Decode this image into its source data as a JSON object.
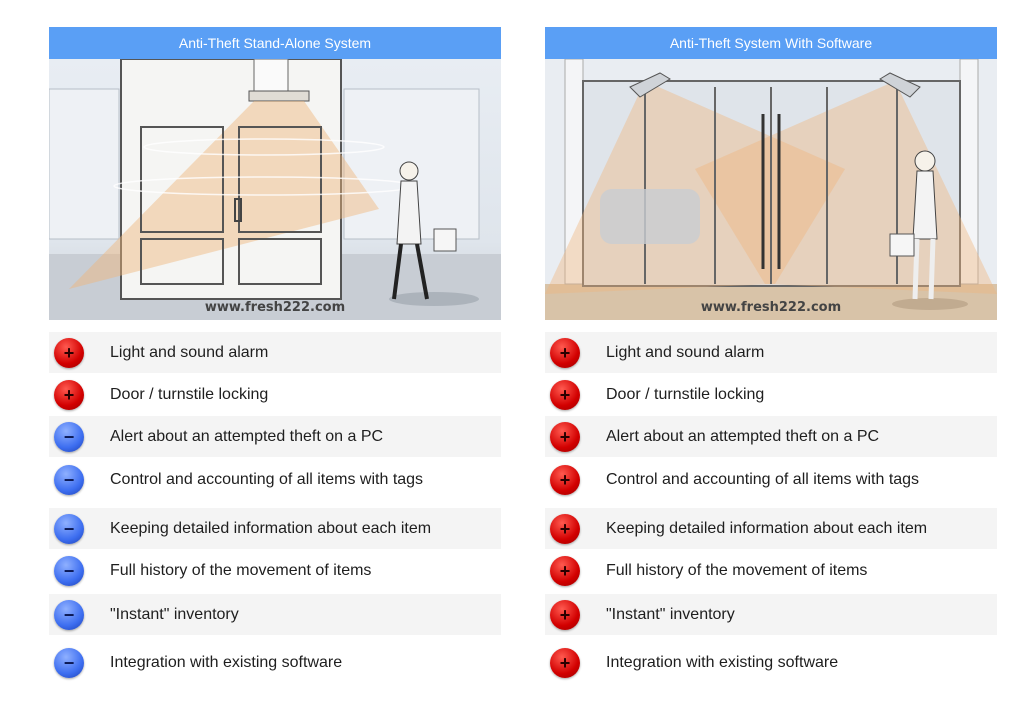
{
  "colors": {
    "header_bg": "#5a9ff5",
    "plus_badge": "#d20000",
    "minus_badge": "#3d6ef0",
    "row_shade": "#f4f4f4"
  },
  "panels": [
    {
      "title": "Anti-Theft Stand-Alone System",
      "illustration": "shop door with single overhead antenna, woman with shopping bag",
      "watermark": "www.fresh222.com",
      "features": [
        {
          "label": "Light and sound alarm",
          "status": "plus",
          "icon": "plus-icon"
        },
        {
          "label": "Door / turnstile locking",
          "status": "plus",
          "icon": "plus-icon"
        },
        {
          "label": "Alert about an attempted theft on a PC",
          "status": "minus",
          "icon": "minus-icon"
        },
        {
          "label": "Control and accounting of all items with tags",
          "status": "minus",
          "icon": "minus-icon"
        },
        {
          "label": "Keeping detailed information about each item",
          "status": "minus",
          "icon": "minus-icon"
        },
        {
          "label": "Full history of the movement of items",
          "status": "minus",
          "icon": "minus-icon"
        },
        {
          "label": "\"Instant\" inventory",
          "status": "minus",
          "icon": "minus-icon"
        },
        {
          "label": "Integration with existing software",
          "status": "minus",
          "icon": "minus-icon"
        }
      ]
    },
    {
      "title": "Anti-Theft System With Software",
      "illustration": "glass storefront with two angled antennas, woman with handbag",
      "watermark": "www.fresh222.com",
      "features": [
        {
          "label": "Light and sound alarm",
          "status": "plus",
          "icon": "plus-icon"
        },
        {
          "label": "Door / turnstile locking",
          "status": "plus",
          "icon": "plus-icon"
        },
        {
          "label": "Alert about an attempted theft on a PC",
          "status": "plus",
          "icon": "plus-icon"
        },
        {
          "label": "Control and accounting of all items with tags",
          "status": "plus",
          "icon": "plus-icon"
        },
        {
          "label": "Keeping detailed information about each item",
          "status": "plus",
          "icon": "plus-icon"
        },
        {
          "label": "Full history of the movement of items",
          "status": "plus",
          "icon": "plus-icon"
        },
        {
          "label": "\"Instant\" inventory",
          "status": "plus",
          "icon": "plus-icon"
        },
        {
          "label": "Integration with existing software",
          "status": "plus",
          "icon": "plus-icon"
        }
      ]
    }
  ]
}
